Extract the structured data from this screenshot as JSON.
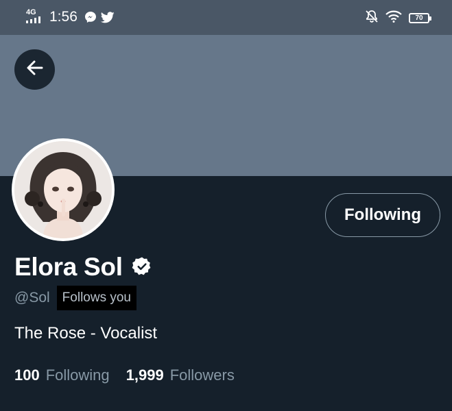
{
  "status_bar": {
    "network": "4G",
    "time": "1:56",
    "battery": "70",
    "app_icons": [
      "messenger-icon",
      "twitter-icon"
    ],
    "right_icons": [
      "notifications-off-icon",
      "wifi-icon",
      "battery-icon"
    ]
  },
  "header": {
    "back_icon": "arrow-left-icon"
  },
  "profile": {
    "follow_button": "Following",
    "display_name": "Elora Sol",
    "verified_icon": "verified-badge-icon",
    "handle": "@Sol",
    "follows_you": "Follows you",
    "bio": "The Rose - Vocalist",
    "following_count": "100",
    "following_label": "Following",
    "followers_count": "1,999",
    "followers_label": "Followers"
  },
  "colors": {
    "background": "#15202b",
    "banner": "#66778a",
    "status_bar": "#4a5766",
    "secondary_text": "#8899a6"
  }
}
